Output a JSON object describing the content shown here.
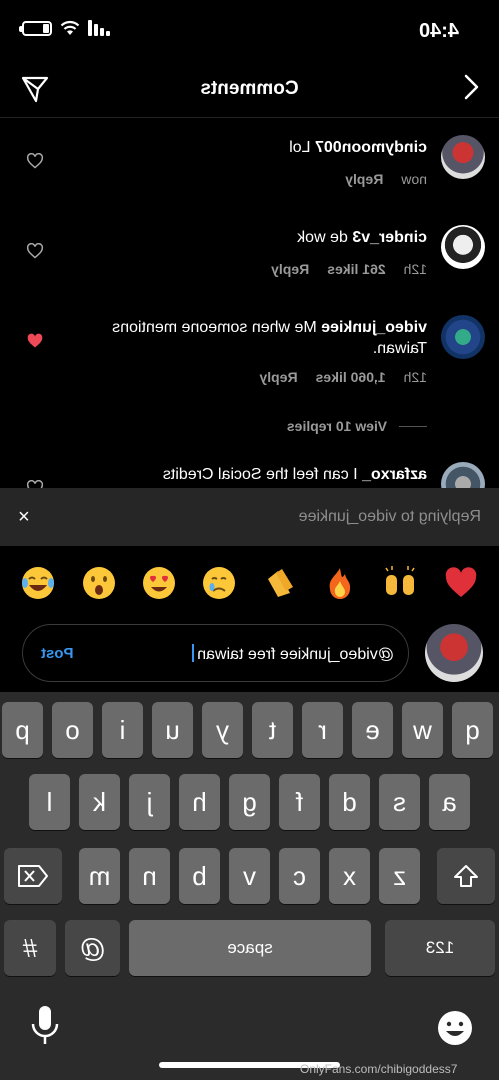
{
  "status": {
    "time": "4:40"
  },
  "header": {
    "title": "Comments"
  },
  "comments": [
    {
      "user": "cindymoon007",
      "text": "Lol",
      "time": "now",
      "likes": "",
      "reply": "Reply",
      "liked": false
    },
    {
      "user": "cinder_v3",
      "text": "de wok",
      "time": "12h",
      "likes": "261 likes",
      "reply": "Reply",
      "liked": false
    },
    {
      "user": "video_junkiee",
      "text": "Me when someone mentions Taiwan.",
      "time": "12h",
      "likes": "1,060 likes",
      "reply": "Reply",
      "liked": true
    },
    {
      "user": "azfarxo_",
      "text": "I can feel the Social Credits",
      "time": "",
      "likes": "",
      "reply": "",
      "liked": false
    }
  ],
  "view_replies": "View 10 replies",
  "reply_bar": {
    "text": "Replying to video_junkiee",
    "close": "×"
  },
  "emojis": [
    "heart",
    "raised-hands",
    "fire",
    "clap",
    "cry",
    "heart-eyes",
    "surprised",
    "laugh-tears"
  ],
  "input": {
    "value": "@video_junkiee free taiwan",
    "post_label": "Post"
  },
  "keyboard": {
    "row1": [
      "q",
      "w",
      "e",
      "r",
      "t",
      "y",
      "u",
      "i",
      "o",
      "p"
    ],
    "row2": [
      "a",
      "s",
      "d",
      "f",
      "g",
      "h",
      "j",
      "k",
      "l"
    ],
    "row3": [
      "z",
      "x",
      "c",
      "v",
      "b",
      "n",
      "m"
    ],
    "numbers": "123",
    "space": "space",
    "at": "@",
    "hash": "#"
  },
  "watermark": "OnlyFans.com/chibigoddess7",
  "colors": {
    "accent": "#3897f0",
    "like": "#ed4956"
  }
}
